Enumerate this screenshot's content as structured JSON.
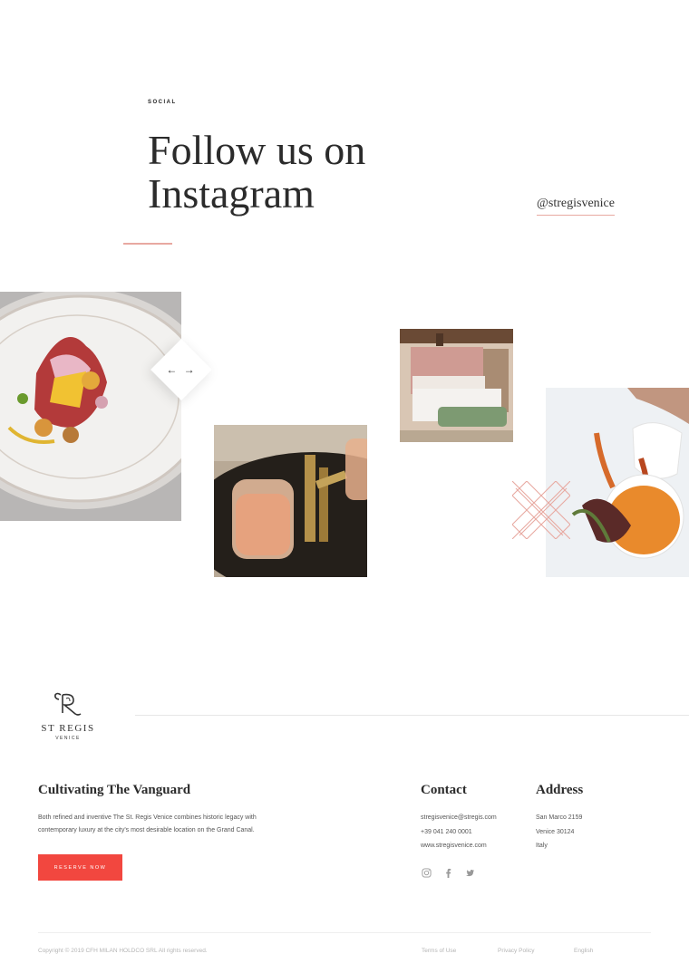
{
  "social_section": {
    "eyebrow": "SOCIAL",
    "headline": "Follow us on Instagram",
    "handle": "@stregisvenice"
  },
  "gallery": {
    "nav_arrows": "← →",
    "images": [
      {
        "icon": "plated-dish-photo"
      },
      {
        "icon": "cocktail-glasses-photo"
      },
      {
        "icon": "hotel-bedroom-photo"
      },
      {
        "icon": "sauce-pouring-photo"
      }
    ]
  },
  "footer": {
    "logo": {
      "name": "ST REGIS",
      "city": "VENICE"
    },
    "about": {
      "title": "Cultivating The Vanguard",
      "text": "Both refined and inventive The St. Regis Venice combines historic legacy with contemporary luxury at the city's most desirable location on the Grand Canal.",
      "cta": "RESERVE NOW"
    },
    "contact": {
      "title": "Contact",
      "email": "stregisvenice@stregis.com",
      "phone": "+39 041 240 0001",
      "website": "www.stregisvenice.com"
    },
    "address": {
      "title": "Address",
      "line1": "San Marco 2159",
      "line2": "Venice 30124",
      "line3": "Italy"
    },
    "social_icons": [
      "instagram-icon",
      "facebook-icon",
      "twitter-icon"
    ],
    "copyright": "Copyright © 2019 CFH MILAN HOLDCO SRL All rights reserved.",
    "terms": "Terms of Use",
    "privacy": "Privacy Policy",
    "language": "English"
  },
  "colors": {
    "accent": "#f2473f",
    "rule": "#e8a9a1"
  }
}
